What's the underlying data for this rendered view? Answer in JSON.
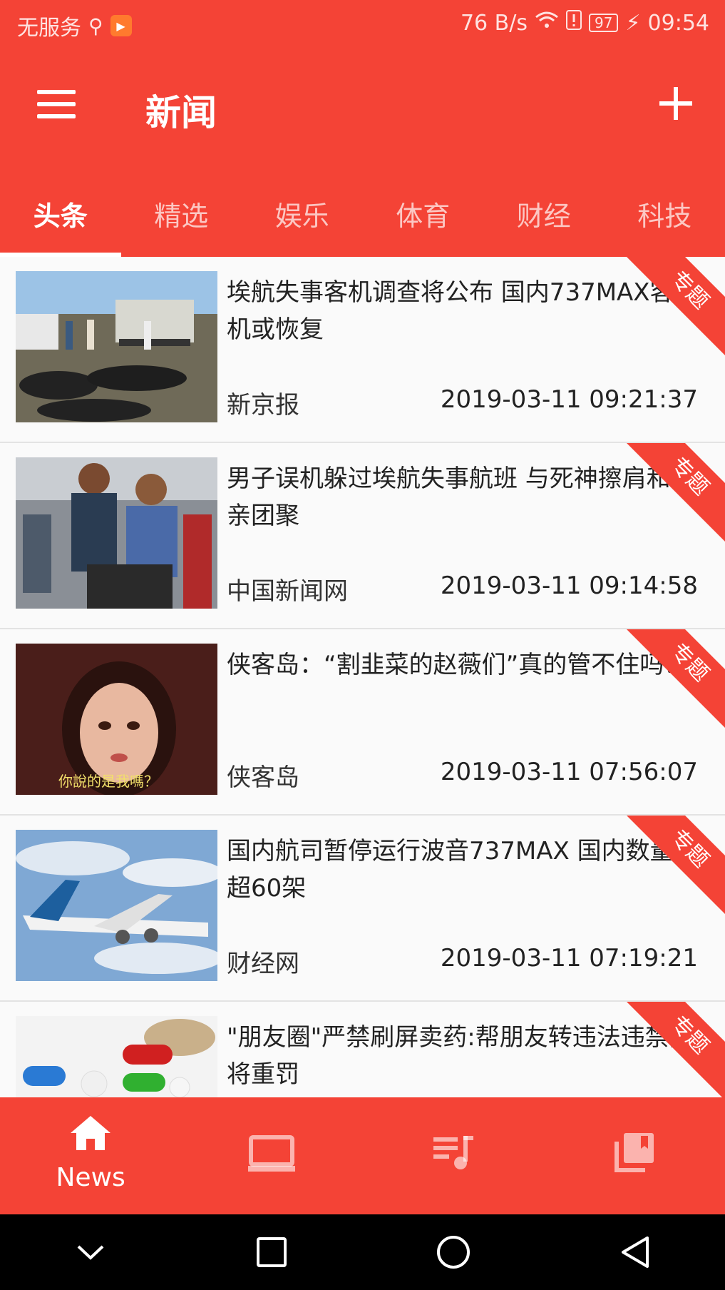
{
  "status_bar": {
    "carrier": "无服务",
    "speed": "76 B/s",
    "battery": "97",
    "time": "09:54"
  },
  "app_bar": {
    "title": "新闻"
  },
  "tabs": [
    "头条",
    "精选",
    "娱乐",
    "体育",
    "财经",
    "科技"
  ],
  "active_tab": "头条",
  "ribbon_label": "专题",
  "news": [
    {
      "title": "埃航失事客机调查将公布 国内737MAX客机或恢复",
      "source": "新京报",
      "time": "2019-03-11 09:21:37"
    },
    {
      "title": "男子误机躲过埃航失事航班 与死神擦肩和父亲团聚",
      "source": "中国新闻网",
      "time": "2019-03-11 09:14:58"
    },
    {
      "title": "侠客岛：“割韭菜的赵薇们”真的管不住吗？",
      "source": "侠客岛",
      "time": "2019-03-11 07:56:07"
    },
    {
      "title": "国内航司暂停运行波音737MAX 国内数量超60架",
      "source": "财经网",
      "time": "2019-03-11 07:19:21"
    },
    {
      "title": "\"朋友圈\"严禁刷屏卖药:帮朋友转违法违禁品将重罚",
      "source": "",
      "time": ""
    }
  ],
  "thumb_captions": {
    "item3": "你說的是我嗎？"
  },
  "bottom_nav": {
    "active_label": "News",
    "items": [
      "home-icon",
      "tv-icon",
      "playlist-icon",
      "library-icon"
    ]
  },
  "colors": {
    "primary": "#f44336",
    "text": "#222222",
    "list_bg": "#fafafa"
  }
}
